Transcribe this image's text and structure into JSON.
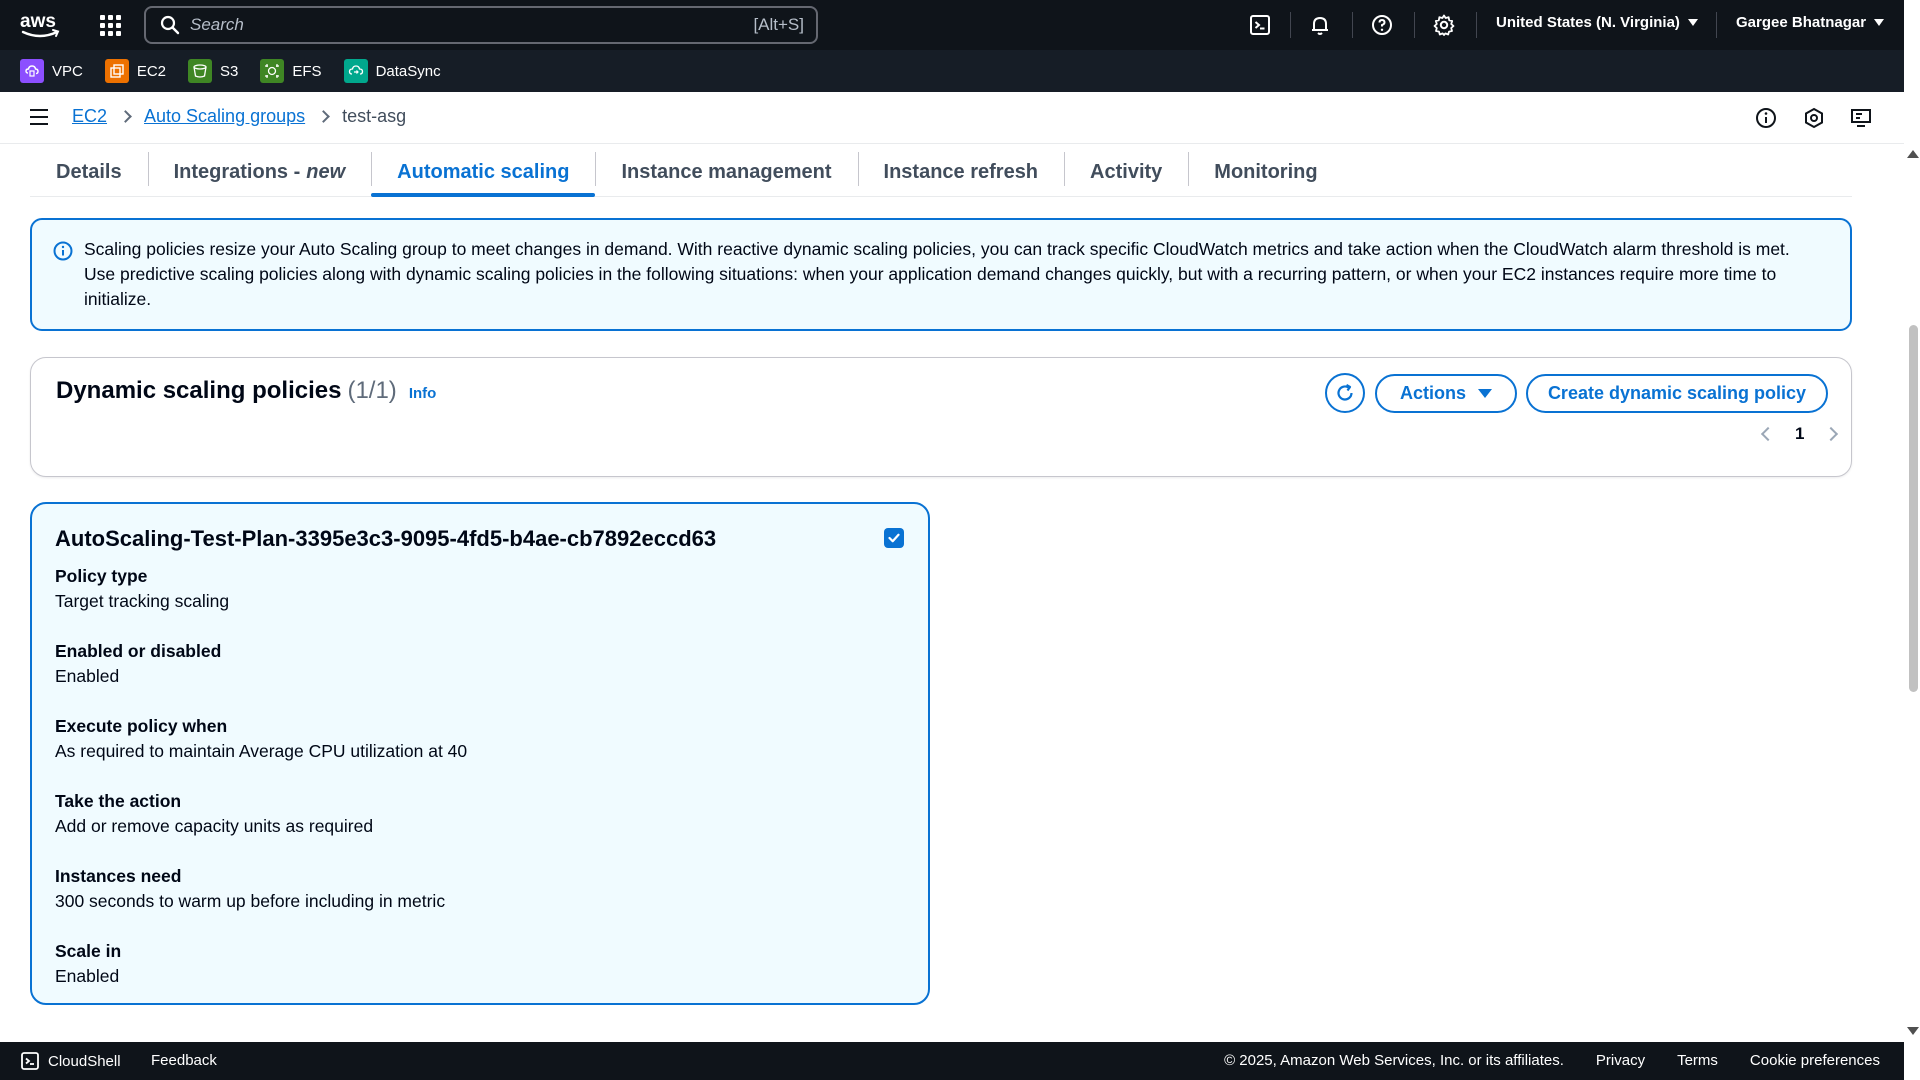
{
  "topbar": {
    "search_placeholder": "Search",
    "search_shortcut": "[Alt+S]",
    "region": "United States (N. Virginia)",
    "user": "Gargee Bhatnagar"
  },
  "favorites": [
    {
      "label": "VPC",
      "color": "#8c4fff"
    },
    {
      "label": "EC2",
      "color": "#ed7100"
    },
    {
      "label": "S3",
      "color": "#3f8624"
    },
    {
      "label": "EFS",
      "color": "#3f8624"
    },
    {
      "label": "DataSync",
      "color": "#01a88d"
    }
  ],
  "breadcrumb": {
    "items": [
      "EC2",
      "Auto Scaling groups"
    ],
    "current": "test-asg"
  },
  "tabs": [
    {
      "label": "Details"
    },
    {
      "label": "Integrations - ",
      "suffix": "new"
    },
    {
      "label": "Automatic scaling",
      "active": true
    },
    {
      "label": "Instance management"
    },
    {
      "label": "Instance refresh"
    },
    {
      "label": "Activity"
    },
    {
      "label": "Monitoring"
    }
  ],
  "alert": {
    "text": "Scaling policies resize your Auto Scaling group to meet changes in demand. With reactive dynamic scaling policies, you can track specific CloudWatch metrics and take action when the CloudWatch alarm threshold is met. Use predictive scaling policies along with dynamic scaling policies in the following situations: when your application demand changes quickly, but with a recurring pattern, or when your EC2 instances require more time to initialize."
  },
  "policies": {
    "title": "Dynamic scaling policies",
    "count": "(1/1)",
    "info": "Info",
    "actions_label": "Actions",
    "create_label": "Create dynamic scaling policy",
    "page": "1"
  },
  "policy_card": {
    "name": "AutoScaling-Test-Plan-3395e3c3-9095-4fd5-b4ae-cb7892eccd63",
    "checked": true,
    "fields": [
      {
        "label": "Policy type",
        "value": "Target tracking scaling"
      },
      {
        "label": "Enabled or disabled",
        "value": "Enabled"
      },
      {
        "label": "Execute policy when",
        "value": "As required to maintain Average CPU utilization at 40"
      },
      {
        "label": "Take the action",
        "value": "Add or remove capacity units as required"
      },
      {
        "label": "Instances need",
        "value": "300 seconds to warm up before including in metric"
      },
      {
        "label": "Scale in",
        "value": "Enabled"
      }
    ]
  },
  "footer": {
    "cloudshell": "CloudShell",
    "feedback": "Feedback",
    "copyright": "© 2025, Amazon Web Services, Inc. or its affiliates.",
    "privacy": "Privacy",
    "terms": "Terms",
    "cookies": "Cookie preferences"
  },
  "colors": {
    "accent": "#0972d3",
    "header_bg": "#0f141a",
    "favbar_bg": "#161d26",
    "alert_bg": "#f0fbff"
  }
}
